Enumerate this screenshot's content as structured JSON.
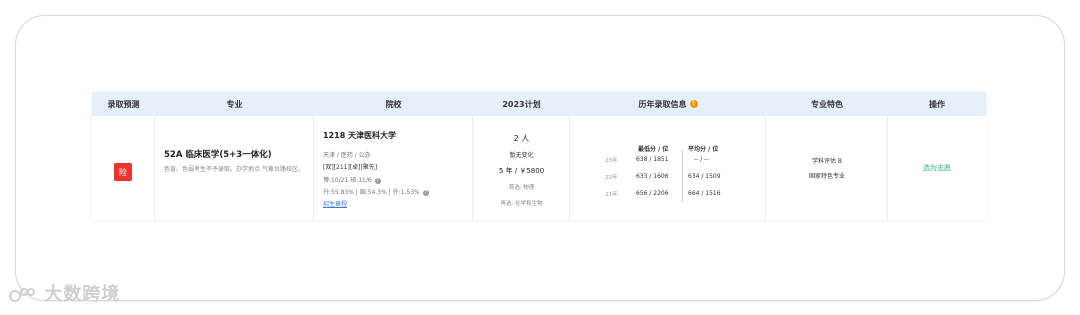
{
  "table": {
    "headers": [
      "录取预测",
      "专业",
      "院校",
      "2023计划",
      "历年录取信息",
      "专业特色",
      "操作"
    ],
    "row": {
      "badge": "险",
      "major": {
        "title": "52A  临床医学(5+3一体化)",
        "note": "色盲、色弱考生不予录取。办学地点:气象台路校区。"
      },
      "school": {
        "name": "1218  天津医科大学",
        "location": "天津 / 医药 / 公办",
        "tags": "[双][211][卓][聚先]",
        "rank": "博:10/21 硕:11/6",
        "rates": "升:55.83% | 国:54.3% | 外:1.53%",
        "link": "招生章程"
      },
      "plan": {
        "count": "2 人",
        "change": "暂无变化",
        "duration_fee": "5 年 / ￥5800",
        "first_subject": "首选:  物理",
        "second_subject": "再选:  化学和生物"
      },
      "history": {
        "min_header": "最低分 / 位",
        "avg_header": "平均分 / 位",
        "rows": [
          {
            "year": "23年",
            "min": "638 / 1851",
            "avg": "-- / --"
          },
          {
            "year": "22年",
            "min": "633 / 1606",
            "avg": "634 / 1509"
          },
          {
            "year": "21年",
            "min": "656 / 2206",
            "avg": "664 / 1516"
          }
        ]
      },
      "feature": {
        "line1": "学科评估 B",
        "line2": "国家特色专业"
      },
      "action": "选为志愿"
    }
  },
  "watermark": "大数跨境",
  "colors": {
    "header_bg": "#e6f0fb",
    "badge_red": "#e8352e",
    "action_green": "#22b573",
    "link_blue": "#3a7bd5",
    "help_orange": "#f39800"
  }
}
